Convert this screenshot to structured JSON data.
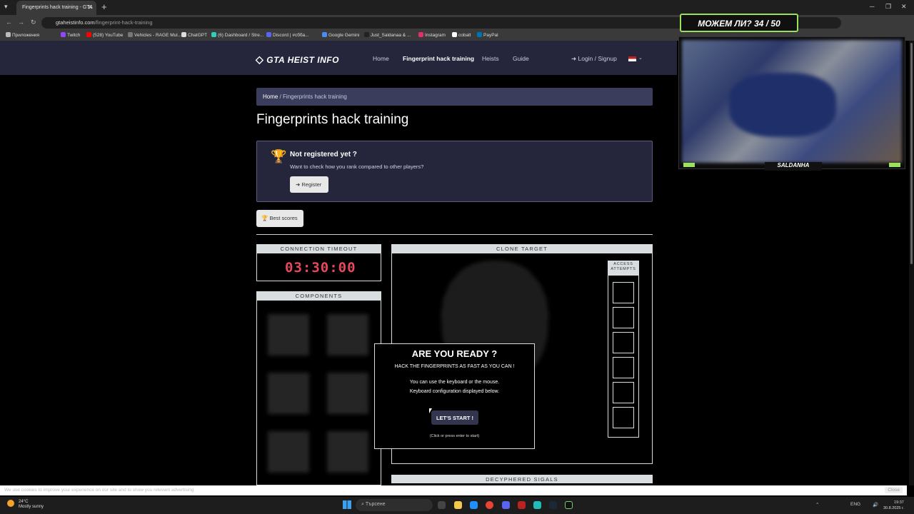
{
  "browser": {
    "tab_title": "Fingerprints hack training - GTA",
    "url_host": "gtaheistinfo.com",
    "url_path": "/fingerprint-hack-training",
    "bookmarks": [
      "Приложения",
      "Twitch",
      "(528) YouTube",
      "Vehicles - RAGE Mul...",
      "ChatGPT",
      "(6) Dashboard / Stre...",
      "Discord | #cбба...",
      "Google Gemini",
      "Just_Saldanaa & ...",
      "Instagram",
      "cobalt",
      "PayPal"
    ]
  },
  "site": {
    "logo": "GTA HEIST INFO",
    "nav": [
      "Home",
      "Fingerprint hack training",
      "Heists",
      "Guide"
    ],
    "login": "Login / Signup",
    "breadcrumb_home": "Home",
    "breadcrumb_current": "Fingerprints hack training",
    "page_title": "Fingerprints hack training",
    "register_title": "Not registered yet ?",
    "register_sub": "Want to check how you rank compared to other players?",
    "register_btn": "Register",
    "best_scores_btn": "Best scores"
  },
  "game": {
    "timeout_label": "CONNECTION TIMEOUT",
    "timer": "03:30:00",
    "components_label": "COMPONENTS",
    "clone_label": "CLONE TARGET",
    "access_label": "ACCESS ATTEMPTS",
    "decyphered_label": "DECYPHERED SIGALS",
    "modal_title": "ARE YOU READY ?",
    "modal_sub": "HACK THE FINGERPRINTS AS FAST AS YOU CAN !",
    "modal_line1": "You can use the keyboard or the mouse.",
    "modal_line2": "Keyboard configuration displayed below.",
    "start_btn": "LET'S START !",
    "modal_hint": "(Click or press enter to start)"
  },
  "cookie": {
    "text": "We use cookies to improve your experience on our site and to show you relevant advertising",
    "close": "Close"
  },
  "overlay": {
    "banner": "МОЖЕМ ЛИ? 34 / 50",
    "cam_name": "SALDANHA"
  },
  "taskbar": {
    "temp": "24°C",
    "weather": "Mostly sunny",
    "search": "Търсене",
    "lang": "ENG",
    "time": "19:37",
    "date": "30.8.2025 г."
  }
}
